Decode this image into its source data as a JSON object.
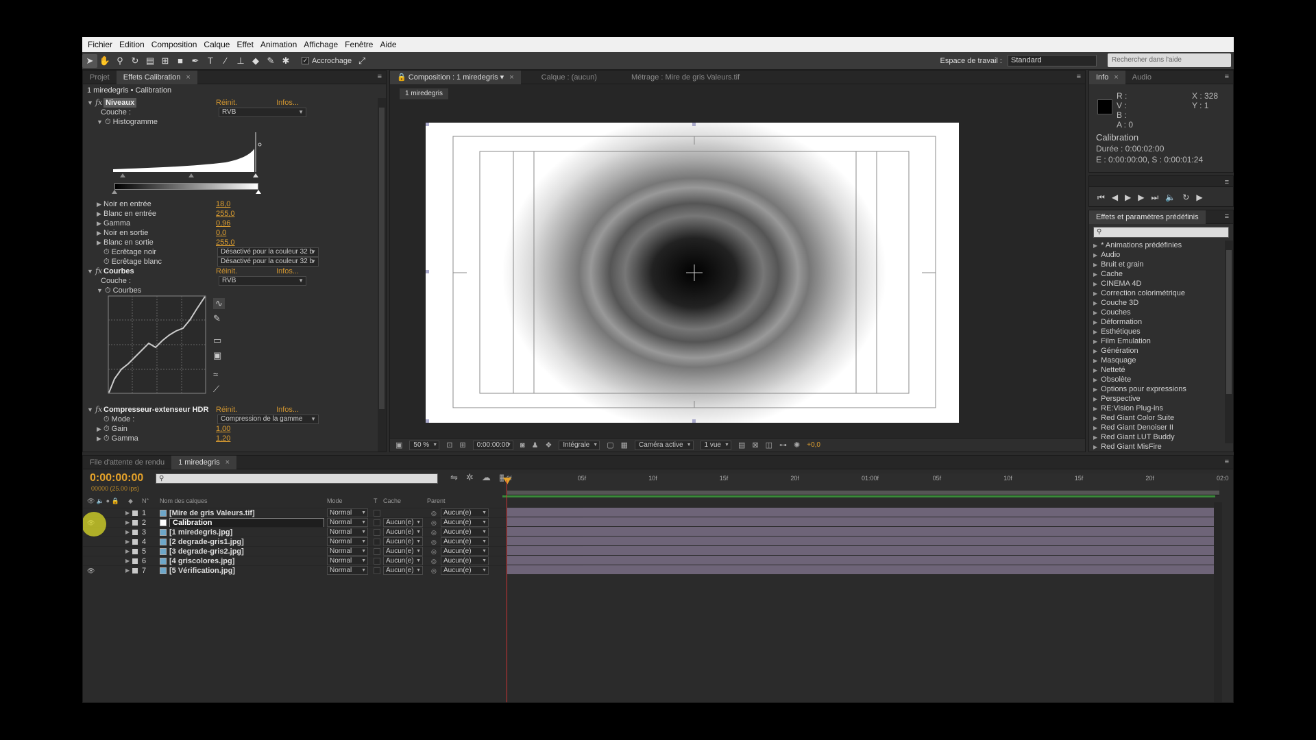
{
  "menu": [
    "Fichier",
    "Edition",
    "Composition",
    "Calque",
    "Effet",
    "Animation",
    "Affichage",
    "Fenêtre",
    "Aide"
  ],
  "toolbar": {
    "tools": [
      "selection-tool",
      "hand-tool",
      "zoom-tool",
      "rotate-tool",
      "camera-tool",
      "pan-behind-tool",
      "rectangle-tool",
      "pen-tool",
      "text-tool",
      "brush-tool",
      "clone-tool",
      "eraser-tool",
      "roto-brush-tool",
      "puppet-tool"
    ],
    "snap_label": "Accrochage",
    "workspace_label": "Espace de travail :",
    "workspace_value": "Standard",
    "search_help_placeholder": "Rechercher dans l'aide"
  },
  "effects_panel": {
    "tabs": [
      "Projet",
      "Effets Calibration"
    ],
    "subtitle": "1 miredegris • Calibration",
    "niveaux": {
      "name": "Niveaux",
      "reset": "Réinit.",
      "info": "Infos...",
      "couche_label": "Couche :",
      "couche_value": "RVB",
      "histogramme_label": "Histogramme",
      "noir_entree_label": "Noir en entrée",
      "noir_entree": "18,0",
      "blanc_entree_label": "Blanc en entrée",
      "blanc_entree": "255,0",
      "gamma_label": "Gamma",
      "gamma": "0,96",
      "noir_sortie_label": "Noir en sortie",
      "noir_sortie": "0,0",
      "blanc_sortie_label": "Blanc en sortie",
      "blanc_sortie": "255,0",
      "ecretage_noir_label": "Ecrêtage noir",
      "ecretage_noir": "Désactivé pour la couleur 32 b",
      "ecretage_blanc_label": "Ecrêtage blanc",
      "ecretage_blanc": "Désactivé pour la couleur 32 b"
    },
    "courbes": {
      "name": "Courbes",
      "reset": "Réinit.",
      "info": "Infos...",
      "couche_label": "Couche :",
      "couche_value": "RVB",
      "courbes_label": "Courbes"
    },
    "hdr": {
      "name": "Compresseur-extenseur HDR",
      "reset": "Réinit.",
      "info": "Infos...",
      "mode_label": "Mode :",
      "mode_value": "Compression de la gamme",
      "gain_label": "Gain",
      "gain": "1,00",
      "gamma_label": "Gamma",
      "gamma": "1,20"
    }
  },
  "comp_panel": {
    "tabs": [
      "Composition : 1 miredegris",
      "Calque : (aucun)",
      "Métrage : Mire de gris Valeurs.tif"
    ],
    "crumb": "1 miredegris",
    "zoom": "50 %",
    "timecode": "0:00:00:00",
    "resolution": "Intégrale",
    "camera": "Caméra active",
    "views": "1 vue",
    "exposure": "+0,0"
  },
  "info_panel": {
    "tabs": [
      "Info",
      "Audio"
    ],
    "r": "R :",
    "v": "V :",
    "b": "B :",
    "a": "A : 0",
    "x": "X : 328",
    "y": "Y : 1",
    "layer_name": "Calibration",
    "duree": "Durée : 0:00:02:00",
    "range": "E : 0:00:00:00, S : 0:00:01:24"
  },
  "presets_panel": {
    "title": "Effets et paramètres prédéfinis",
    "search_placeholder": "",
    "items": [
      "* Animations prédéfinies",
      "Audio",
      "Bruit et grain",
      "Cache",
      "CINEMA 4D",
      "Correction colorimétrique",
      "Couche 3D",
      "Couches",
      "Déformation",
      "Esthétiques",
      "Film Emulation",
      "Génération",
      "Masquage",
      "Netteté",
      "Obsolète",
      "Options pour expressions",
      "Perspective",
      "RE:Vision Plug-ins",
      "Red Giant Color Suite",
      "Red Giant Denoiser II",
      "Red Giant LUT Buddy",
      "Red Giant MisFire"
    ]
  },
  "timeline": {
    "tabs": [
      "File d'attente de rendu",
      "1 miredegris"
    ],
    "time": "0:00:00:00",
    "fps": "00000 (25.00 ips)",
    "col_num": "N°",
    "col_name": "Nom des calques",
    "col_mode": "Mode",
    "col_t": "T",
    "col_cache": "Cache",
    "col_parent": "Parent",
    "ruler": [
      "0f",
      "05f",
      "10f",
      "15f",
      "20f",
      "01:00f",
      "05f",
      "10f",
      "15f",
      "20f",
      "02:0"
    ],
    "layers": [
      {
        "num": "1",
        "name": "[Mire de gris Valeurs.tif]",
        "mode": "Normal",
        "cache": "",
        "parent": "Aucun(e)"
      },
      {
        "num": "2",
        "name": "Calibration",
        "mode": "Normal",
        "cache": "Aucun(e)",
        "parent": "Aucun(e)"
      },
      {
        "num": "3",
        "name": "[1 miredegris.jpg]",
        "mode": "Normal",
        "cache": "Aucun(e)",
        "parent": "Aucun(e)"
      },
      {
        "num": "4",
        "name": "[2 degrade-gris1.jpg]",
        "mode": "Normal",
        "cache": "Aucun(e)",
        "parent": "Aucun(e)"
      },
      {
        "num": "5",
        "name": "[3 degrade-gris2.jpg]",
        "mode": "Normal",
        "cache": "Aucun(e)",
        "parent": "Aucun(e)"
      },
      {
        "num": "6",
        "name": "[4 griscolores.jpg]",
        "mode": "Normal",
        "cache": "Aucun(e)",
        "parent": "Aucun(e)"
      },
      {
        "num": "7",
        "name": "[5 Vérification.jpg]",
        "mode": "Normal",
        "cache": "Aucun(e)",
        "parent": "Aucun(e)"
      }
    ]
  },
  "colors": {
    "accent": "#e5a22a",
    "layer_bar": "#a593b8",
    "cti": "#cc3333"
  }
}
